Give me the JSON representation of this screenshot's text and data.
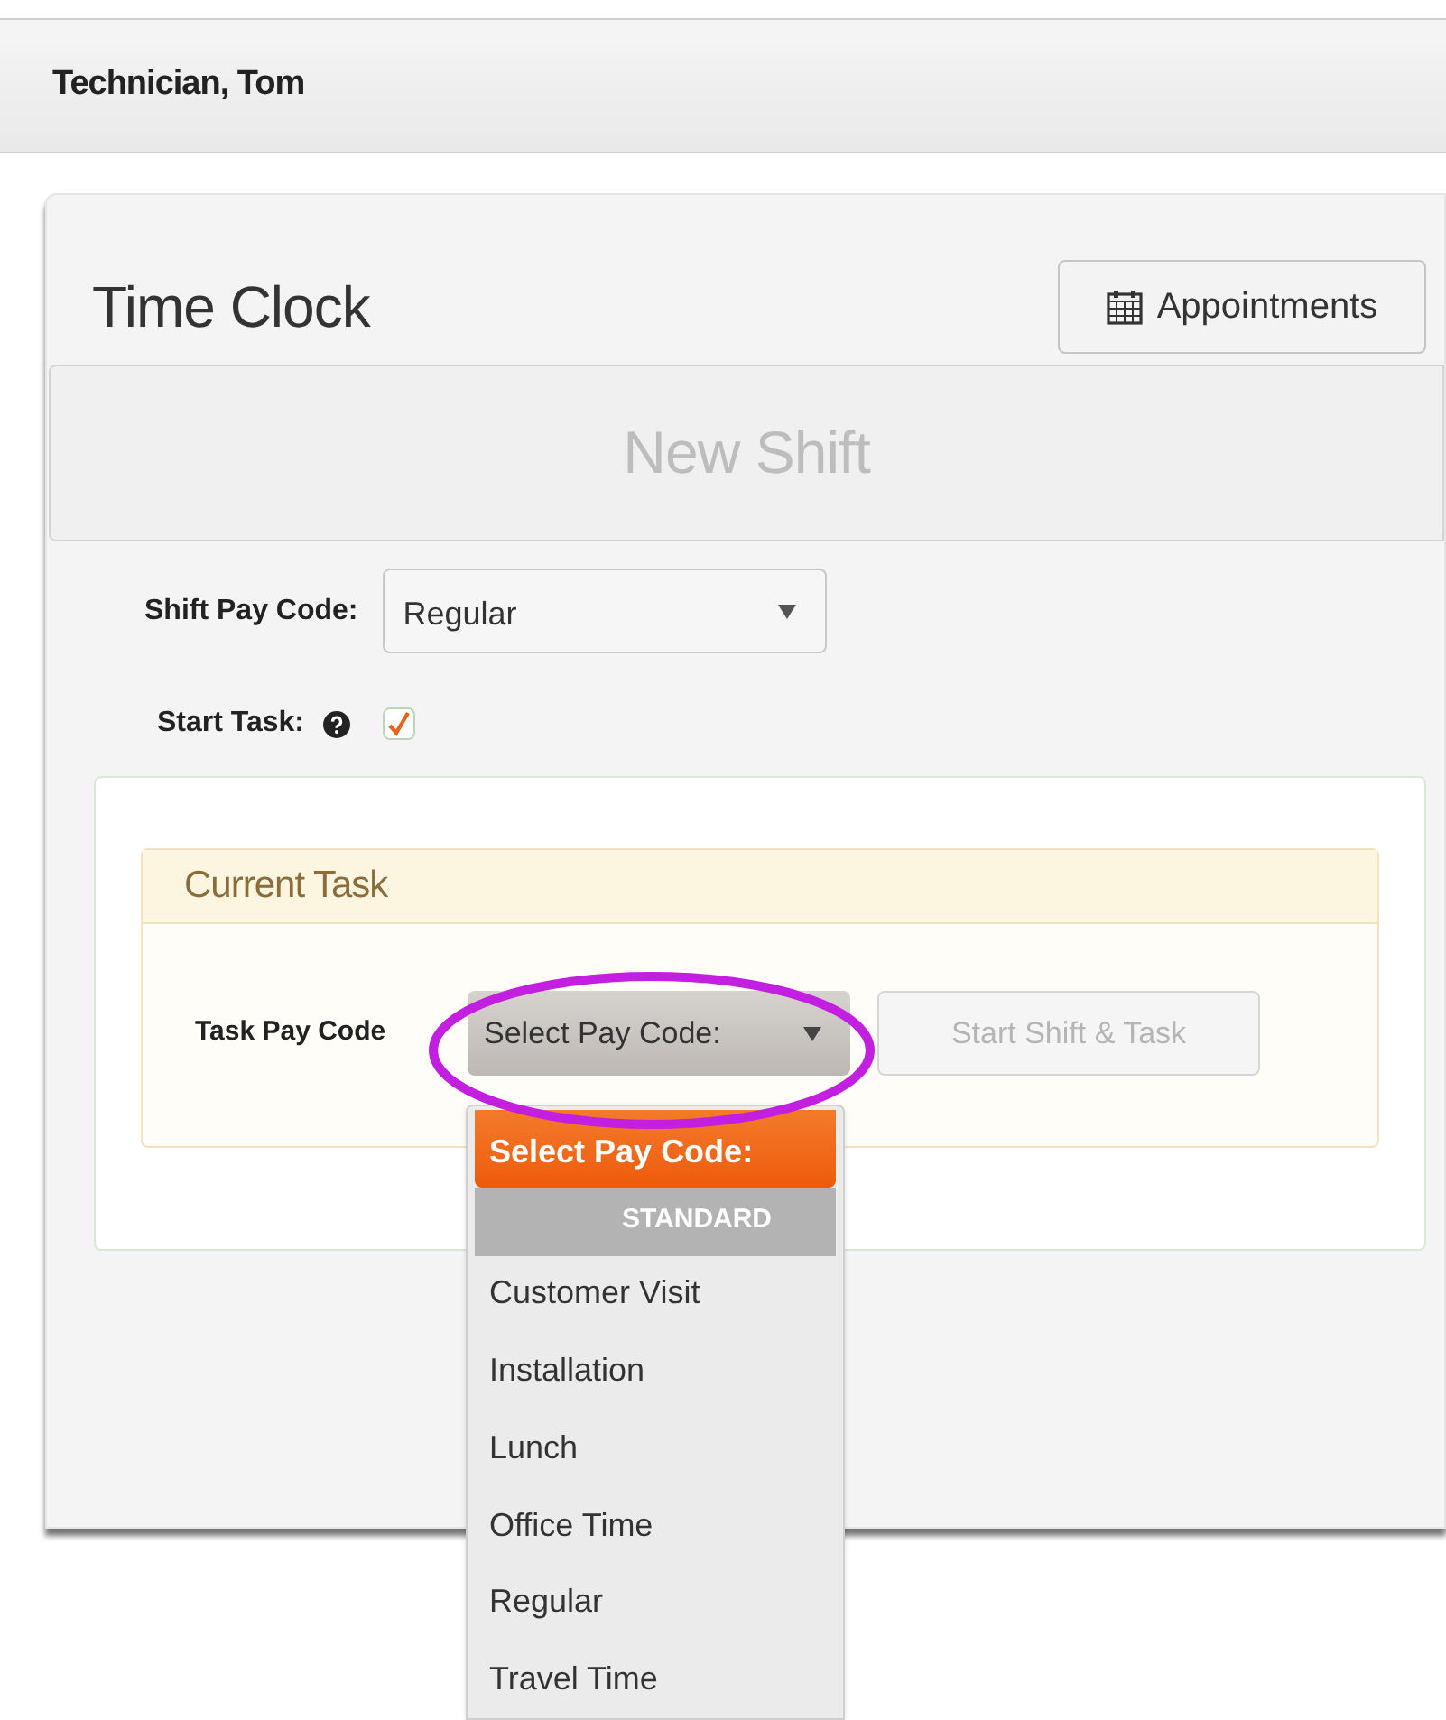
{
  "header": {
    "user": "Technician, Tom"
  },
  "card": {
    "title": "Time Clock",
    "appointments_button": "Appointments",
    "shift_banner": "New Shift"
  },
  "shift_pay_code": {
    "label": "Shift Pay Code:",
    "value": "Regular"
  },
  "start_task": {
    "label": "Start Task:",
    "checked": true
  },
  "current_task": {
    "title": "Current Task",
    "pay_code_label": "Task Pay Code",
    "select_value": "Select Pay Code:",
    "button": {
      "label": "Start Shift & Task",
      "disabled": true
    }
  },
  "dropdown": {
    "items": [
      {
        "kind": "option",
        "label": "Select Pay Code:",
        "selected": true
      },
      {
        "kind": "group",
        "label": "STANDARD"
      },
      {
        "kind": "option",
        "label": "Customer Visit",
        "selected": false
      },
      {
        "kind": "option",
        "label": "Installation",
        "selected": false
      },
      {
        "kind": "option",
        "label": "Lunch",
        "selected": false
      },
      {
        "kind": "option",
        "label": "Office Time",
        "selected": false
      },
      {
        "kind": "option",
        "label": "Regular",
        "selected": false
      },
      {
        "kind": "option",
        "label": "Travel Time",
        "selected": false
      }
    ]
  }
}
